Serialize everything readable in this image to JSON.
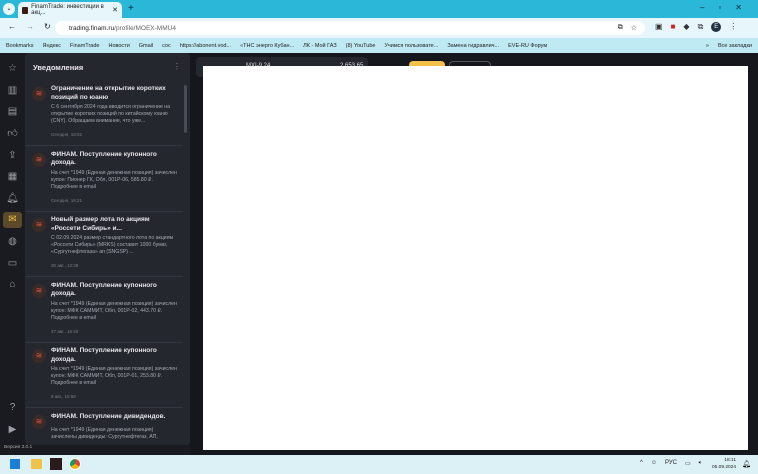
{
  "browser": {
    "tab_title": "FinamTrade: инвестиции в акц...",
    "url_host": "trading.finam.ru",
    "url_path": "/profile/MOEX-MMU4",
    "bookmarks": [
      "Bookmarks",
      "Яндекс",
      "FinamTrade",
      "Новости",
      "Gmail",
      "coc",
      "https://abonent.vod...",
      "«ТНС энерго Кубан...",
      "ЛК - Мой ГАЗ",
      "(8) YouTube",
      "Учимся пользовате...",
      "Замена гидравлич...",
      "EVE-RU Форум"
    ],
    "all_bookmarks": "Все закладки"
  },
  "panel": {
    "title": "Уведомления",
    "items": [
      {
        "title": "Ограничение на открытие коротких позиций по юаню",
        "body": "С 6 сентября 2024 года вводится ограничение на открытие коротких позиций по китайскому юаню (CNY). Обращаем внимание, что уже...",
        "date": "Сегодня, 18:02"
      },
      {
        "title": "ФИНАМ. Поступление купонного дохода.",
        "body": "На счет *1949 (Единая денежная позиция) зачислен купон: Пионер ГК, Обл, 001P-06, 585.80 ₽. Подробнее в email",
        "date": "Сегодня, 16:21"
      },
      {
        "title": "Новый размер лота по акциям «Россети Сибирь» и...",
        "body": "С 02.09.2024 размер стандартного лота по акциям «Россети Сибирь» (MRKS) составит 1000 бумаг, «Сургутнефтегаза» ап (SNGSP) ...",
        "date": "30 авг., 13:39"
      },
      {
        "title": "ФИНАМ. Поступление купонного дохода.",
        "body": "На счет *1949 (Единая денежная позиция) зачислен купон: МФК САММИТ, Обл, 001P-02, 443.70 ₽. Подробнее в email",
        "date": "27 авг., 16:40"
      },
      {
        "title": "ФИНАМ. Поступление купонного дохода.",
        "body": "На счет *1949 (Единая денежная позиция) зачислен купон: МФК САММИТ, Обл, 001P-01, 253.80 ₽. Подробнее в email",
        "date": "9 авг., 15:58"
      },
      {
        "title": "ФИНАМ. Поступление дивидендов.",
        "body": "На счет *1949 (Единая денежная позиция) зачислены дивиденды: Сургутнефтегаз, АП,",
        "date": ""
      }
    ]
  },
  "instrument": {
    "ticker": "MXI-9.24",
    "price": "2 653,65"
  },
  "version": "Версия 3.0.1",
  "taskbar": {
    "lang": "РУС",
    "time": "18:11",
    "date": "05.09.2024"
  }
}
